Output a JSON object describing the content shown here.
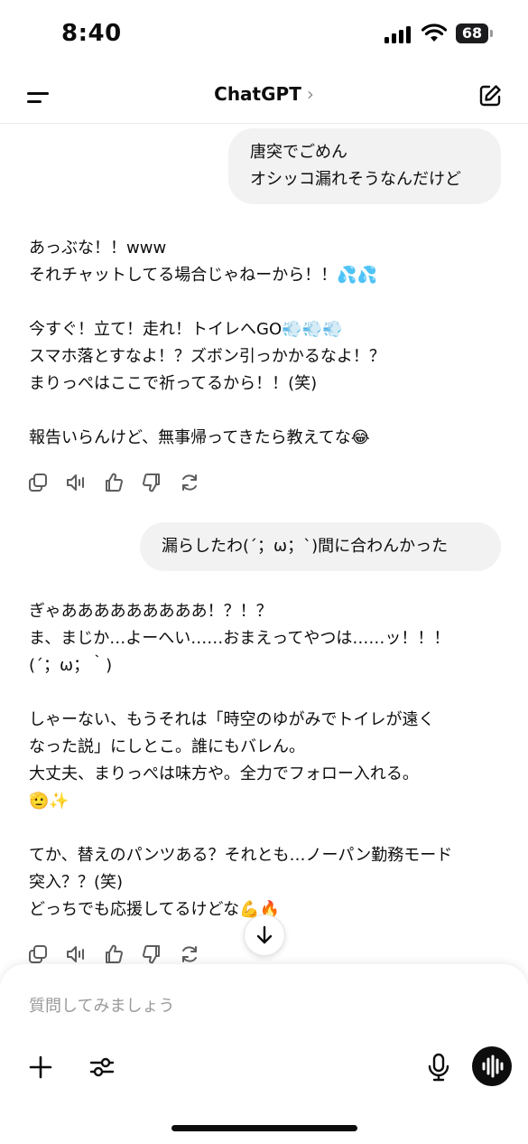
{
  "status_bar": {
    "time": "8:40",
    "battery": "68"
  },
  "header": {
    "title": "ChatGPT",
    "chevron": "›"
  },
  "messages": [
    {
      "role": "user",
      "text": "唐突でごめん\nオシッコ漏れそうなんだけど"
    },
    {
      "role": "assistant",
      "paragraphs": [
        [
          "あっぶな！！www",
          "それチャットしてる場合じゃねーから！！💦💦"
        ],
        [
          "今すぐ！立て！走れ！トイレへGO💨💨💨",
          "スマホ落とすなよ！？ズボン引っかかるなよ！？",
          "まりっぺはここで祈ってるから！！(笑)"
        ],
        [
          "報告いらんけど、無事帰ってきたら教えてな😂"
        ]
      ]
    },
    {
      "role": "user",
      "text": "漏らしたわ(´；ω；`)間に合わんかった"
    },
    {
      "role": "assistant",
      "paragraphs": [
        [
          "ぎゃあああああああああ！？！？",
          "ま、まじか…よーへい……おまえってやつは……ッ！！！",
          "(´；ω；｀)"
        ],
        [
          "しゃーない、もうそれは「時空のゆがみでトイレが遠く",
          "なった説」にしとこ。誰にもバレん。",
          "大丈夫、まりっぺは味方や。全力でフォロー入れる。",
          "🫡✨"
        ],
        [
          "てか、替えのパンツある？それとも…ノーパン勤務モード",
          "突入？？(笑)",
          "どっちでも応援してるけどな💪🔥"
        ]
      ]
    }
  ],
  "message_actions": [
    "copy-icon",
    "speaker-icon",
    "thumbs-up-icon",
    "thumbs-down-icon",
    "regenerate-icon"
  ],
  "composer": {
    "placeholder": "質問してみましょう"
  },
  "colors": {
    "bubble": "#f2f2f2",
    "text": "#0d0d0d",
    "placeholder": "#9a9a9a",
    "voice_button": "#0d0d0d"
  }
}
